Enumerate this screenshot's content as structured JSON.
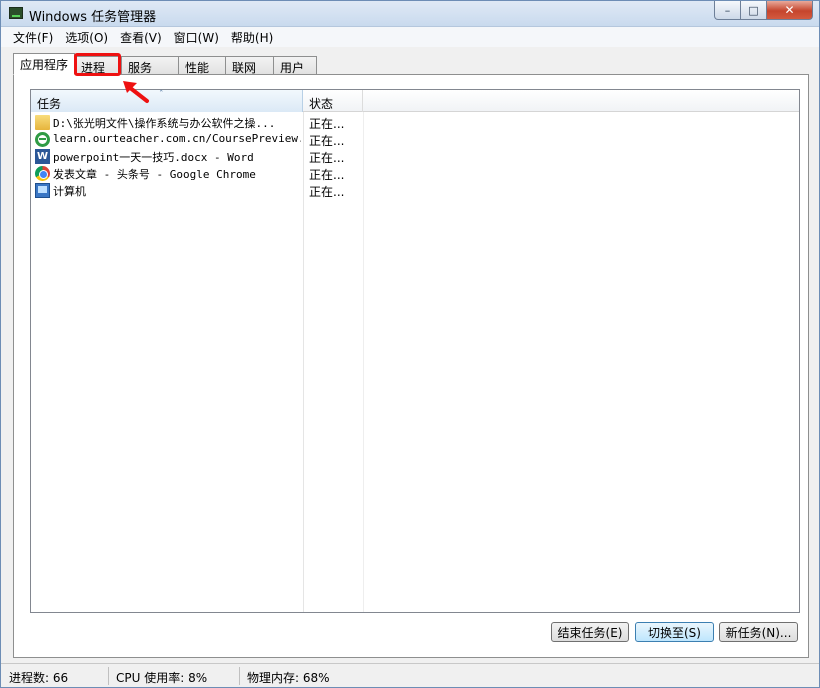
{
  "window": {
    "title": "Windows 任务管理器"
  },
  "caption_buttons": {
    "minimize": "–",
    "maximize": "□",
    "close": "✕"
  },
  "menu": [
    "文件(F)",
    "选项(O)",
    "查看(V)",
    "窗口(W)",
    "帮助(H)"
  ],
  "tabs": [
    "应用程序",
    "进程",
    "服务",
    "性能",
    "联网",
    "用户"
  ],
  "active_tab": "应用程序",
  "highlighted_tab": "进程",
  "highlight_color": "#ee1111",
  "table": {
    "columns": [
      "任务",
      "状态"
    ],
    "sort_indicator": "ˆ",
    "rows": [
      {
        "icon": "folder-icon",
        "task": "D:\\张光明文件\\操作系统与办公软件之操...",
        "status": "正在..."
      },
      {
        "icon": "ie-icon",
        "task": "learn.ourteacher.com.cn/CoursePreview...",
        "status": "正在..."
      },
      {
        "icon": "word-icon",
        "task": "powerpoint一天一技巧.docx - Word",
        "status": "正在..."
      },
      {
        "icon": "chrome-icon",
        "task": "发表文章 - 头条号 - Google Chrome",
        "status": "正在..."
      },
      {
        "icon": "computer-icon",
        "task": "计算机",
        "status": "正在..."
      }
    ]
  },
  "word_icon_glyph": "W",
  "buttons": {
    "end_task": "结束任务(E)",
    "switch_to": "切换至(S)",
    "new_task": "新任务(N)..."
  },
  "status": {
    "processes": "进程数: 66",
    "cpu": "CPU 使用率: 8%",
    "memory": "物理内存: 68%"
  }
}
